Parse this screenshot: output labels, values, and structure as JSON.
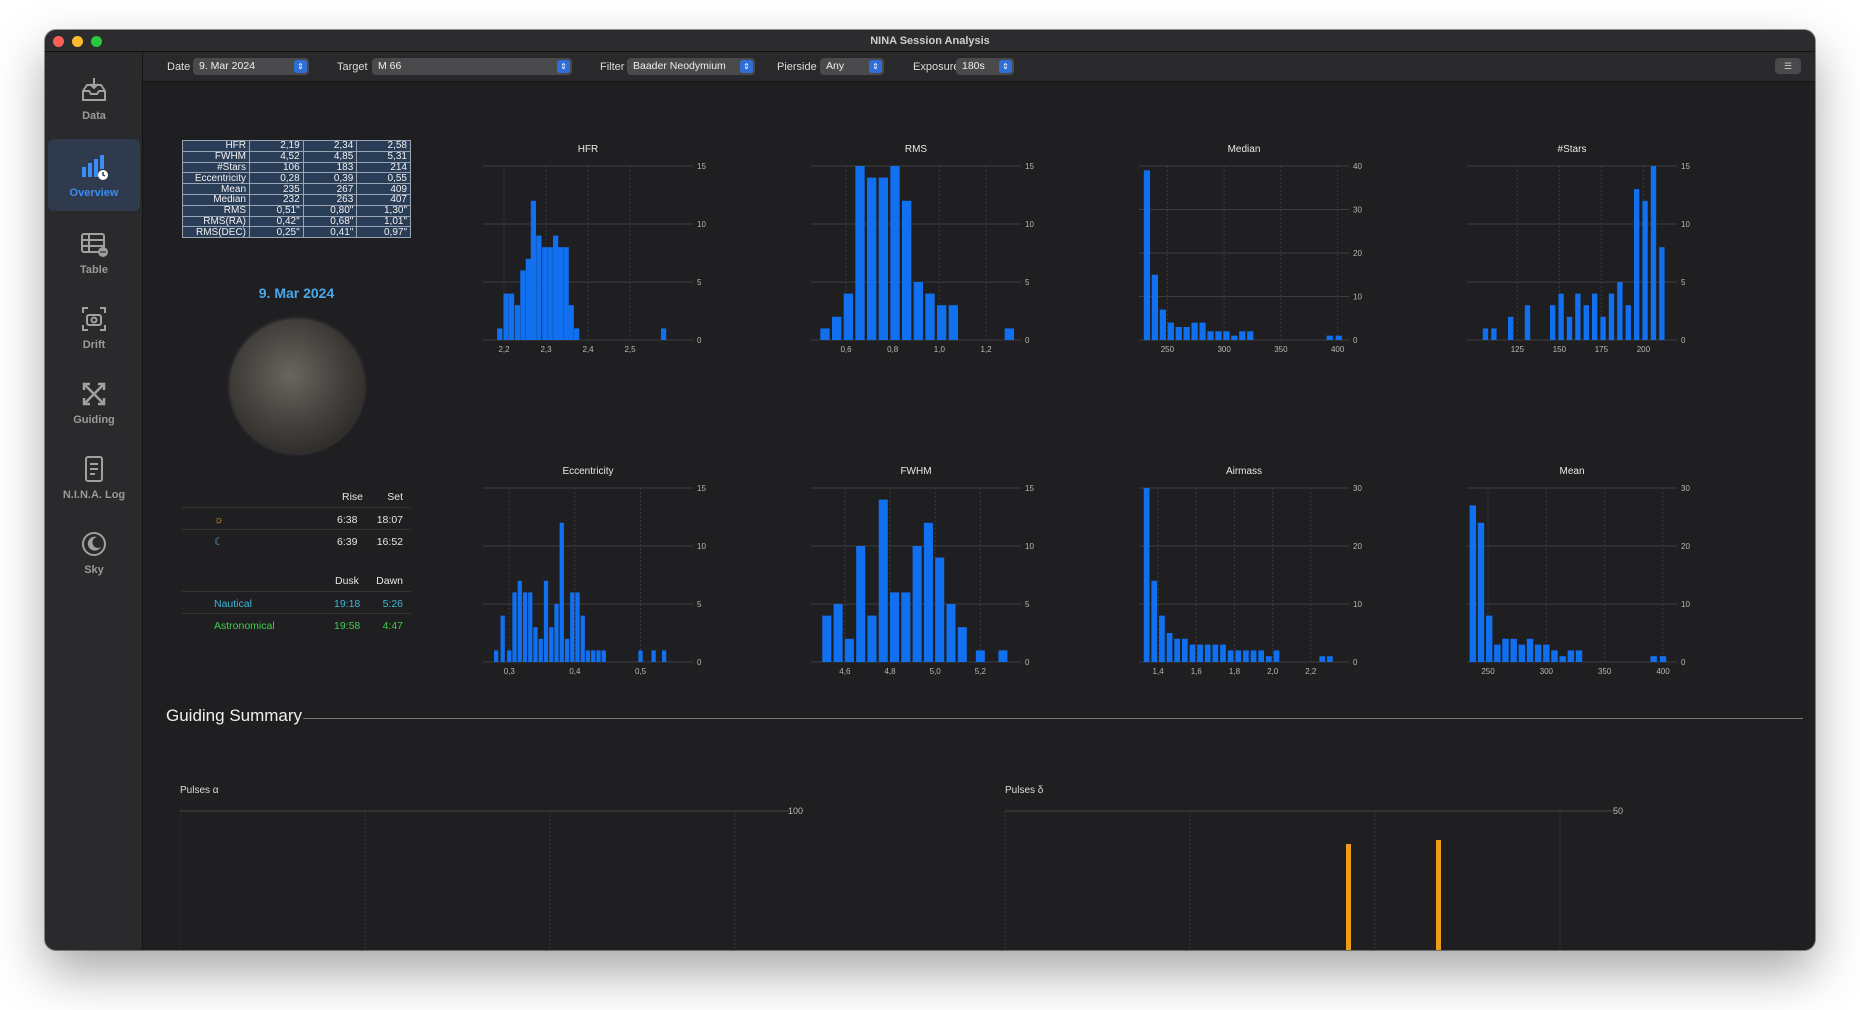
{
  "window": {
    "title": "NINA Session Analysis"
  },
  "sidebar": {
    "items": [
      {
        "label": "Data",
        "icon": "tray-download-icon"
      },
      {
        "label": "Overview",
        "icon": "chart-overview-icon",
        "active": true
      },
      {
        "label": "Table",
        "icon": "table-icon"
      },
      {
        "label": "Drift",
        "icon": "camera-drift-icon"
      },
      {
        "label": "Guiding",
        "icon": "arrows-expand-icon"
      },
      {
        "label": "N.I.N.A. Log",
        "icon": "document-log-icon"
      },
      {
        "label": "Sky",
        "icon": "moon-sky-icon"
      }
    ]
  },
  "toolbar": {
    "date_label": "Date",
    "date_value": "9. Mar 2024",
    "target_label": "Target",
    "target_value": "M 66",
    "filter_label": "Filter",
    "filter_value": "Baader Neodymium",
    "pierside_label": "Pierside",
    "pierside_value": "Any",
    "exposure_label": "Exposure",
    "exposure_value": "180s"
  },
  "stats": [
    [
      "HFR",
      "2,19",
      "2,34",
      "2,58"
    ],
    [
      "FWHM",
      "4,52",
      "4,85",
      "5,31"
    ],
    [
      "#Stars",
      "106",
      "183",
      "214"
    ],
    [
      "Eccentricity",
      "0,28",
      "0,39",
      "0,55"
    ],
    [
      "Mean",
      "235",
      "267",
      "409"
    ],
    [
      "Median",
      "232",
      "263",
      "407"
    ],
    [
      "RMS",
      "0,51\"",
      "0,80\"",
      "1,30\""
    ],
    [
      "RMS(RA)",
      "0,42\"",
      "0,68\"",
      "1,01\""
    ],
    [
      "RMS(DEC)",
      "0,25\"",
      "0,41\"",
      "0,97\""
    ]
  ],
  "sky": {
    "date": "9. Mar 2024",
    "rise_header": "Rise",
    "set_header": "Set",
    "sun": {
      "icon": "sun-icon",
      "rise": "6:38",
      "set": "18:07"
    },
    "moon": {
      "icon": "crescent-moon-icon",
      "rise": "6:39",
      "set": "16:52"
    },
    "dusk_header": "Dusk",
    "dawn_header": "Dawn",
    "nautical": {
      "label": "Nautical",
      "dusk": "19:18",
      "dawn": "5:26",
      "color": "#3fb6d8"
    },
    "astronomical": {
      "label": "Astronomical",
      "dusk": "19:58",
      "dawn": "4:47",
      "color": "#3ccf4e"
    }
  },
  "guiding": {
    "title": "Guiding Summary",
    "pulses_ra_label": "Pulses α",
    "pulses_dec_label": "Pulses δ",
    "pulses_ra_ymax": "100",
    "pulses_dec_ymax": "50"
  },
  "colors": {
    "bar": "#1170f0",
    "accent": "#3b8cf5",
    "orange": "#f09a1a"
  },
  "chart_data": [
    {
      "type": "bar",
      "title": "HFR",
      "xlim": [
        2.15,
        2.65
      ],
      "ylim": [
        0,
        15
      ],
      "yticks": [
        0,
        5,
        10,
        15
      ],
      "xticks": [
        {
          "v": 2.2,
          "l": "2,2"
        },
        {
          "v": 2.3,
          "l": "2,3"
        },
        {
          "v": 2.4,
          "l": "2,4"
        },
        {
          "v": 2.5,
          "l": "2,5"
        }
      ],
      "bin_width": 0.0125,
      "x": [
        2.19,
        2.205,
        2.218,
        2.232,
        2.245,
        2.258,
        2.27,
        2.283,
        2.297,
        2.31,
        2.323,
        2.335,
        2.348,
        2.36,
        2.373,
        2.386,
        2.398,
        2.411,
        2.424,
        2.58
      ],
      "values": [
        1,
        4,
        4,
        3,
        6,
        7,
        12,
        9,
        8,
        8,
        9,
        8,
        8,
        3,
        1,
        0,
        0,
        0,
        0,
        1
      ]
    },
    {
      "type": "bar",
      "title": "RMS",
      "xlim": [
        0.45,
        1.35
      ],
      "ylim": [
        0,
        15
      ],
      "yticks": [
        0,
        5,
        10,
        15
      ],
      "xticks": [
        {
          "v": 0.6,
          "l": "0,6"
        },
        {
          "v": 0.8,
          "l": "0,8"
        },
        {
          "v": 1.0,
          "l": "1,0"
        },
        {
          "v": 1.2,
          "l": "1,2"
        }
      ],
      "bin_width": 0.04,
      "x": [
        0.51,
        0.56,
        0.61,
        0.66,
        0.71,
        0.76,
        0.81,
        0.86,
        0.91,
        0.96,
        1.01,
        1.06,
        1.3
      ],
      "values": [
        1,
        2,
        4,
        15,
        14,
        14,
        15,
        12,
        5,
        4,
        3,
        3,
        1
      ]
    },
    {
      "type": "bar",
      "title": "Median",
      "xlim": [
        225,
        410
      ],
      "ylim": [
        0,
        40
      ],
      "yticks": [
        0,
        10,
        20,
        30,
        40
      ],
      "xticks": [
        {
          "v": 250,
          "l": "250"
        },
        {
          "v": 300,
          "l": "300"
        },
        {
          "v": 350,
          "l": "350"
        },
        {
          "v": 400,
          "l": "400"
        }
      ],
      "bin_width": 5.5,
      "x": [
        232,
        239,
        246,
        253,
        260,
        267,
        274,
        281,
        288,
        295,
        302,
        309,
        316,
        323,
        330,
        337,
        344,
        393,
        401
      ],
      "values": [
        39,
        15,
        7,
        4,
        3,
        3,
        4,
        4,
        2,
        2,
        2,
        1,
        2,
        2,
        0,
        0,
        0,
        1,
        1
      ]
    },
    {
      "type": "bar",
      "title": "#Stars",
      "xlim": [
        95,
        220
      ],
      "ylim": [
        0,
        15
      ],
      "yticks": [
        0,
        5,
        10,
        15
      ],
      "xticks": [
        {
          "v": 125,
          "l": "125"
        },
        {
          "v": 150,
          "l": "150"
        },
        {
          "v": 175,
          "l": "175"
        },
        {
          "v": 200,
          "l": "200"
        }
      ],
      "bin_width": 3.2,
      "x": [
        106,
        111,
        121,
        131,
        141,
        146,
        151,
        156,
        161,
        166,
        171,
        176,
        181,
        186,
        191,
        196,
        201,
        206,
        211
      ],
      "values": [
        1,
        1,
        2,
        3,
        0,
        3,
        4,
        2,
        4,
        3,
        4,
        2,
        4,
        5,
        3,
        13,
        12,
        15,
        8
      ]
    },
    {
      "type": "bar",
      "title": "Eccentricity",
      "xlim": [
        0.26,
        0.58
      ],
      "ylim": [
        0,
        15
      ],
      "yticks": [
        0,
        5,
        10,
        15
      ],
      "xticks": [
        {
          "v": 0.3,
          "l": "0,3"
        },
        {
          "v": 0.4,
          "l": "0,4"
        },
        {
          "v": 0.5,
          "l": "0,5"
        }
      ],
      "bin_width": 0.0065,
      "x": [
        0.28,
        0.29,
        0.3,
        0.308,
        0.316,
        0.324,
        0.332,
        0.34,
        0.348,
        0.356,
        0.364,
        0.372,
        0.38,
        0.388,
        0.396,
        0.404,
        0.412,
        0.42,
        0.428,
        0.436,
        0.444,
        0.452,
        0.46,
        0.468,
        0.476,
        0.484,
        0.5,
        0.52,
        0.536,
        0.548
      ],
      "values": [
        1,
        4,
        1,
        6,
        7,
        6,
        6,
        3,
        2,
        7,
        3,
        5,
        12,
        2,
        6,
        6,
        4,
        1,
        1,
        1,
        1,
        0,
        0,
        0,
        0,
        0,
        1,
        1,
        1,
        0
      ]
    },
    {
      "type": "bar",
      "title": "FWHM",
      "xlim": [
        4.45,
        5.38
      ],
      "ylim": [
        0,
        15
      ],
      "yticks": [
        0,
        5,
        10,
        15
      ],
      "xticks": [
        {
          "v": 4.6,
          "l": "4,6"
        },
        {
          "v": 4.8,
          "l": "4,8"
        },
        {
          "v": 5.0,
          "l": "5,0"
        },
        {
          "v": 5.2,
          "l": "5,2"
        }
      ],
      "bin_width": 0.04,
      "x": [
        4.52,
        4.57,
        4.62,
        4.67,
        4.72,
        4.77,
        4.82,
        4.87,
        4.92,
        4.97,
        5.02,
        5.07,
        5.12,
        5.2,
        5.3
      ],
      "values": [
        4,
        5,
        2,
        10,
        4,
        14,
        6,
        6,
        10,
        12,
        9,
        5,
        3,
        1,
        1
      ]
    },
    {
      "type": "bar",
      "title": "Airmass",
      "xlim": [
        1.3,
        2.4
      ],
      "ylim": [
        0,
        30
      ],
      "yticks": [
        0,
        10,
        20,
        30
      ],
      "xticks": [
        {
          "v": 1.4,
          "l": "1,4"
        },
        {
          "v": 1.6,
          "l": "1,6"
        },
        {
          "v": 1.8,
          "l": "1,8"
        },
        {
          "v": 2.0,
          "l": "2,0"
        },
        {
          "v": 2.2,
          "l": "2,2"
        }
      ],
      "bin_width": 0.03,
      "x": [
        1.34,
        1.38,
        1.42,
        1.46,
        1.5,
        1.54,
        1.58,
        1.62,
        1.66,
        1.7,
        1.74,
        1.78,
        1.82,
        1.86,
        1.9,
        1.94,
        1.98,
        2.02,
        2.06,
        2.26,
        2.3
      ],
      "values": [
        30,
        14,
        8,
        5,
        4,
        4,
        3,
        3,
        3,
        3,
        3,
        2,
        2,
        2,
        2,
        2,
        1,
        2,
        0,
        1,
        1
      ]
    },
    {
      "type": "bar",
      "title": "Mean",
      "xlim": [
        232,
        412
      ],
      "ylim": [
        0,
        30
      ],
      "yticks": [
        0,
        10,
        20,
        30
      ],
      "xticks": [
        {
          "v": 250,
          "l": "250"
        },
        {
          "v": 300,
          "l": "300"
        },
        {
          "v": 350,
          "l": "350"
        },
        {
          "v": 400,
          "l": "400"
        }
      ],
      "bin_width": 5.5,
      "x": [
        237,
        244,
        251,
        258,
        265,
        272,
        279,
        286,
        293,
        300,
        307,
        314,
        321,
        328,
        335,
        342,
        349,
        356,
        392,
        400
      ],
      "values": [
        27,
        24,
        8,
        3,
        4,
        4,
        3,
        4,
        3,
        3,
        2,
        1,
        2,
        2,
        0,
        0,
        0,
        0,
        1,
        1
      ]
    }
  ]
}
